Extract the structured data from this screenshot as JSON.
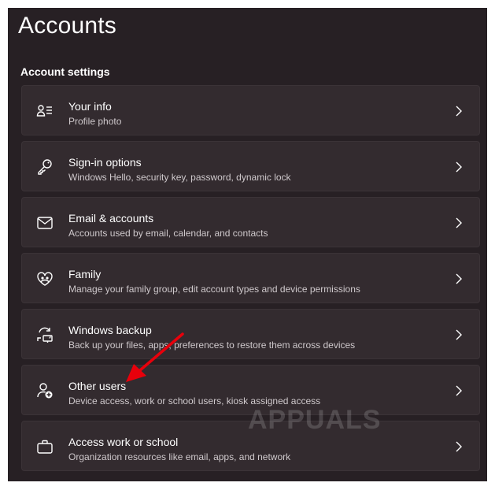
{
  "page": {
    "title": "Accounts",
    "section_title": "Account settings"
  },
  "items": [
    {
      "icon": "person-list-icon",
      "label": "Your info",
      "sublabel": "Profile photo"
    },
    {
      "icon": "key-icon",
      "label": "Sign-in options",
      "sublabel": "Windows Hello, security key, password, dynamic lock"
    },
    {
      "icon": "mail-icon",
      "label": "Email & accounts",
      "sublabel": "Accounts used by email, calendar, and contacts"
    },
    {
      "icon": "family-heart-icon",
      "label": "Family",
      "sublabel": "Manage your family group, edit account types and device permissions"
    },
    {
      "icon": "backup-sync-icon",
      "label": "Windows backup",
      "sublabel": "Back up your files, apps, preferences to restore them across devices"
    },
    {
      "icon": "person-add-icon",
      "label": "Other users",
      "sublabel": "Device access, work or school users, kiosk assigned access"
    },
    {
      "icon": "briefcase-icon",
      "label": "Access work or school",
      "sublabel": "Organization resources like email, apps, and network"
    }
  ],
  "watermark": "APPUALS",
  "colors": {
    "background": "#272024",
    "card": "#332b2f",
    "annotation_arrow": "#e8000b"
  }
}
